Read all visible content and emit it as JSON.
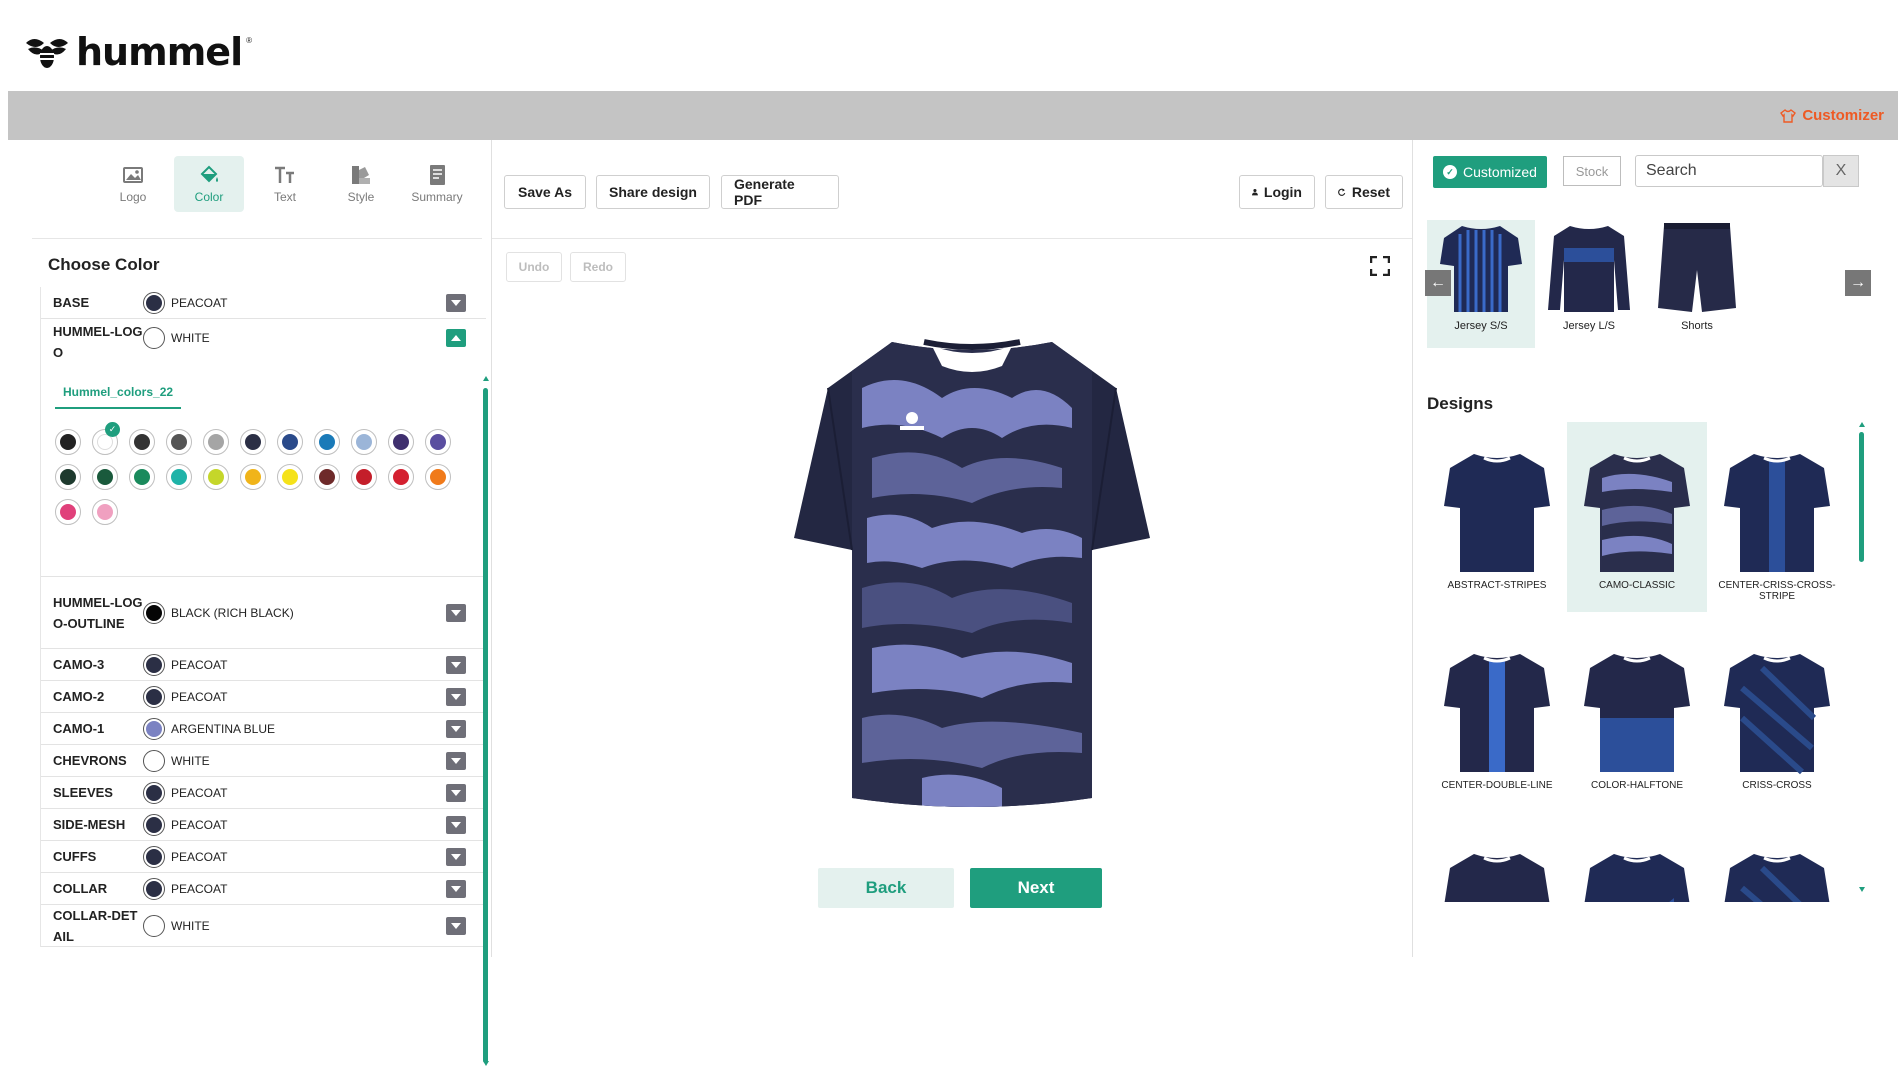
{
  "brand": {
    "name": "hummel",
    "registered": "®"
  },
  "topbar": {
    "customizer_label": "Customizer"
  },
  "tabs": [
    {
      "label": "Logo",
      "icon": "image-icon"
    },
    {
      "label": "Color",
      "icon": "paint-bucket-icon",
      "active": true
    },
    {
      "label": "Text",
      "icon": "text-icon"
    },
    {
      "label": "Style",
      "icon": "palette-icon"
    },
    {
      "label": "Summary",
      "icon": "document-icon"
    }
  ],
  "color_panel": {
    "title": "Choose Color",
    "rows": [
      {
        "label": "BASE",
        "value": "PEACOAT",
        "color": "#2b2f45"
      },
      {
        "label": "HUMMEL-LOGO",
        "value": "WHITE",
        "color": "#ffffff",
        "open": true
      },
      {
        "label": "HUMMEL-LOGO-OUTLINE",
        "value": "BLACK (RICH BLACK)",
        "color": "#050505"
      },
      {
        "label": "CAMO-3",
        "value": "PEACOAT",
        "color": "#2b2f45"
      },
      {
        "label": "CAMO-2",
        "value": "PEACOAT",
        "color": "#2b2f45"
      },
      {
        "label": "CAMO-1",
        "value": "ARGENTINA BLUE",
        "color": "#7b82c2"
      },
      {
        "label": "CHEVRONS",
        "value": "WHITE",
        "color": "#ffffff"
      },
      {
        "label": "SLEEVES",
        "value": "PEACOAT",
        "color": "#2b2f45"
      },
      {
        "label": "SIDE-MESH",
        "value": "PEACOAT",
        "color": "#2b2f45"
      },
      {
        "label": "CUFFS",
        "value": "PEACOAT",
        "color": "#2b2f45"
      },
      {
        "label": "COLLAR",
        "value": "PEACOAT",
        "color": "#2b2f45"
      },
      {
        "label": "COLLAR-DETAIL",
        "value": "WHITE",
        "color": "#ffffff"
      }
    ],
    "palette_tab": "Hummel_colors_22",
    "palette_colors": [
      "#222222",
      "#ffffff",
      "#333333",
      "#555555",
      "#a5a5a5",
      "#2b2f45",
      "#2a4a8a",
      "#1a7ab8",
      "#9bb5d8",
      "#3f2f6e",
      "#5a4ea0",
      "#1e3a2e",
      "#1a5a3c",
      "#1a8a5c",
      "#1fb3a8",
      "#c5d62a",
      "#f0b41a",
      "#f5e21a",
      "#6e2a2a",
      "#c41e2a",
      "#d42030",
      "#f07a1a",
      "#e0407a",
      "#f0a0c0"
    ],
    "palette_selected_index": 1
  },
  "toolbar": {
    "save_as": "Save As",
    "share": "Share design",
    "pdf": "Generate PDF",
    "login": "Login",
    "reset": "Reset",
    "undo": "Undo",
    "redo": "Redo"
  },
  "nav": {
    "back": "Back",
    "next": "Next"
  },
  "catalog": {
    "customized": "Customized",
    "stock": "Stock",
    "search_placeholder": "Search",
    "clear": "X",
    "products": [
      {
        "label": "Jersey S/S",
        "selected": true
      },
      {
        "label": "Jersey L/S"
      },
      {
        "label": "Shorts"
      }
    ],
    "designs_title": "Designs",
    "designs": [
      {
        "label": "ABSTRACT-STRIPES"
      },
      {
        "label": "CAMO-CLASSIC",
        "selected": true
      },
      {
        "label": "CENTER-CRISS-CROSS-STRIPE"
      },
      {
        "label": "CENTER-DOUBLE-LINE"
      },
      {
        "label": "COLOR-HALFTONE"
      },
      {
        "label": "CRISS-CROSS"
      },
      {
        "label": ""
      },
      {
        "label": ""
      },
      {
        "label": ""
      }
    ]
  }
}
